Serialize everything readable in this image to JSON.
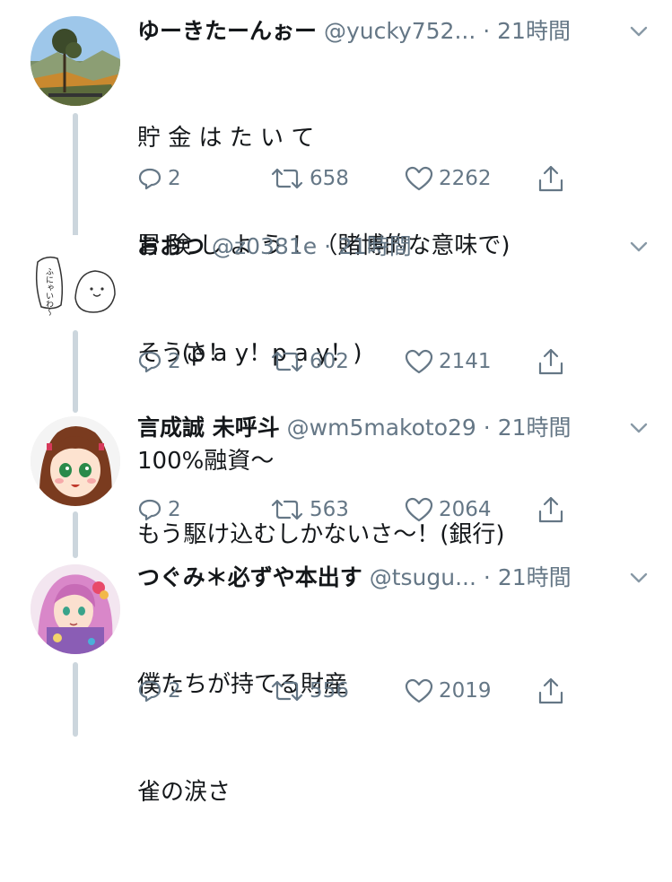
{
  "tweets": [
    {
      "name": "ゆーきたーんぉー",
      "handle": "@yucky752...",
      "dot": "·",
      "time": "21時間",
      "lines": [
        "貯 金 は た い て",
        "冒 険 し よ う ！（賭博的な意味で)",
        "      (p a y！p a y！)"
      ],
      "replies": "2",
      "retweets": "658",
      "likes": "2262",
      "avatar_icon": "landscape-avatar"
    },
    {
      "name": "おおつ",
      "handle": "@z0381e",
      "dot": "·",
      "time": "21時間",
      "lines": [
        "そうさ！",
        "100%融資〜"
      ],
      "replies": "2",
      "retweets": "602",
      "likes": "2141",
      "avatar_icon": "sketch-avatar",
      "avatar_text": "ふにゃいわ〜"
    },
    {
      "name": "言成誠 未呼斗",
      "handle": "@wm5makoto29",
      "dot": "·",
      "time": "21時間",
      "lines": [
        "もう駆け込むしかないさ〜！(銀行)"
      ],
      "replies": "2",
      "retweets": "563",
      "likes": "2064",
      "avatar_icon": "anime-girl-avatar"
    },
    {
      "name": "つぐみ＊必ずや本出す",
      "handle": "@tsugu...",
      "dot": "·",
      "time": "21時間",
      "lines": [
        "僕たちが持てる財産",
        "雀の涙さ"
      ],
      "replies": "2",
      "retweets": "556",
      "likes": "2019",
      "avatar_icon": "illustrated-girl-avatar"
    }
  ],
  "colors": {
    "text": "#14171a",
    "secondary": "#657786",
    "thread_line": "#ccd6dd"
  }
}
